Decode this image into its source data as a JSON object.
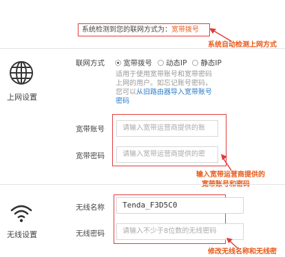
{
  "detect": {
    "prefix": "系统检测到您的联网方式为：",
    "value": "宽带拨号"
  },
  "annotations": {
    "auto_detect": "系统自动检测上网方式",
    "enter_account_line1": "输入宽带运营商提供的",
    "enter_account_line2": "宽带账号和密码",
    "modify_wifi": "修改无线名称和无线密"
  },
  "internet": {
    "section_label": "上网设置",
    "mode_label": "联网方式",
    "modes": [
      "宽带拨号",
      "动态IP",
      "静态IP"
    ],
    "hint_line1": "适用于使用宽带账号和宽带密码",
    "hint_line2": "上网的用户。如忘记账号密码，",
    "hint_line3_prefix": "您可以",
    "hint_link_line3": "从旧路由器导入宽带账号",
    "hint_link_line4": "密码",
    "account_label": "宽带账号",
    "account_placeholder": "请输入宽带运营商提供的账",
    "password_label": "宽带密码",
    "password_placeholder": "请输入宽带运营商提供的密"
  },
  "wireless": {
    "section_label": "无线设置",
    "name_label": "无线名称",
    "name_value": "Tenda_F3D5C0",
    "password_label": "无线密码",
    "password_placeholder": "请输入不少于8位数的无线密码"
  },
  "colors": {
    "accent_red": "#e23a3a",
    "annotation_orange": "#e85a1a",
    "link_blue": "#2a7ac8"
  }
}
